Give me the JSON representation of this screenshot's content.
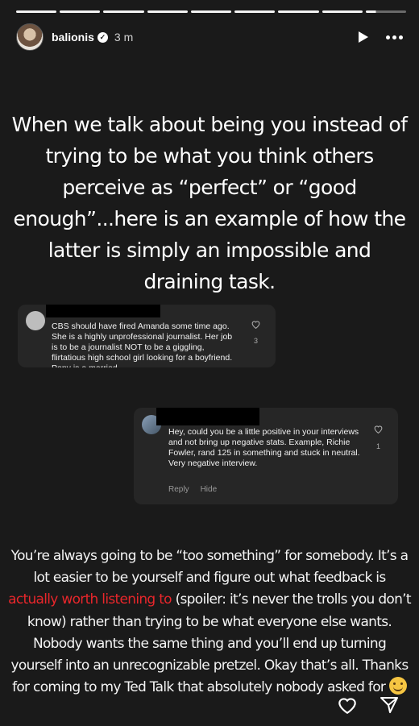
{
  "header": {
    "username": "balionis",
    "verified_glyph": "✓",
    "time_ago": "3 m",
    "icons": [
      "play-icon",
      "more-icon"
    ]
  },
  "story": {
    "progress_segments": 9,
    "current_segment_progress": 0.25,
    "headline": "When we talk about being you instead of trying to be what you think others perceive as “perfect” or “good enough”...here is an example of how the latter is simply an impossible and draining task."
  },
  "comments": [
    {
      "text": "CBS should have fired Amanda some time ago. She is a highly unprofessional journalist. Her job is to be a journalist NOT to be a giggling, flirtatious high school girl looking for a boyfriend. Pony is a married",
      "likes": "3"
    },
    {
      "text": "Hey, could you be a little positive in your interviews and not bring up negative stats. Example, Richie Fowler, rand 125 in something and stuck in neutral. Very negative interview.",
      "likes": "1",
      "reply_label": "Reply",
      "hide_label": "Hide"
    }
  ],
  "message": {
    "part1": "You’re always going to be “too something” for somebody. It’s a lot easier to be yourself and figure out what feedback is ",
    "highlight": "actually worth listening to",
    "part2": " (spoiler: it’s never the trolls you don’t know) rather than trying to be what everyone else wants. Nobody wants the same thing and you’ll end up turning yourself into an unrecognizable pretzel. Okay that’s all. Thanks for coming to my Ted Talk that absolutely nobody asked for ",
    "highlight_color": "#e8262b",
    "emoji_icon": "smiling-face-icon"
  },
  "footer": {
    "icons": [
      "heart-icon",
      "send-icon"
    ]
  }
}
